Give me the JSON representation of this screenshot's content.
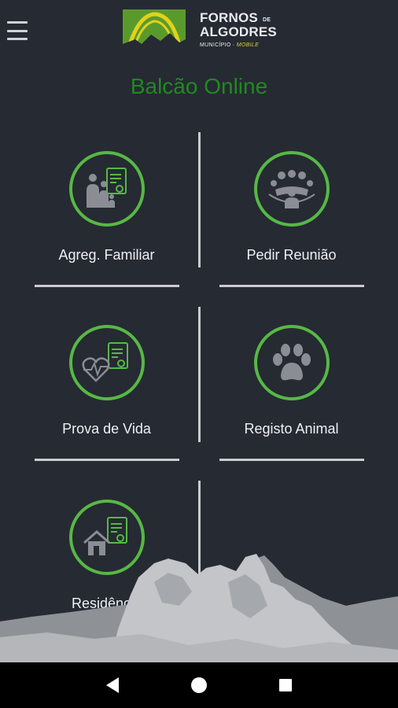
{
  "header": {
    "menu_icon": "hamburger-menu-icon",
    "logo": {
      "line1": "FORNOS",
      "de": "DE",
      "line2": "ALGODRES",
      "sub": "MUNICÍPIO",
      "sub_sep": " · ",
      "sub_mobile": "MOBILE"
    }
  },
  "page": {
    "title": "Balcão Online"
  },
  "services": [
    {
      "label": "Agreg. Familiar",
      "icon": "family-document-icon"
    },
    {
      "label": "Pedir Reunião",
      "icon": "meeting-group-icon"
    },
    {
      "label": "Prova de Vida",
      "icon": "heartbeat-document-icon"
    },
    {
      "label": "Registo Animal",
      "icon": "paw-icon"
    },
    {
      "label": "Residência",
      "icon": "house-document-icon"
    }
  ],
  "colors": {
    "accent": "#1f8a1f",
    "ring": "#57b845",
    "background": "#262a33"
  },
  "navbar": {
    "back": "back-icon",
    "home": "home-icon",
    "recents": "recents-icon"
  }
}
